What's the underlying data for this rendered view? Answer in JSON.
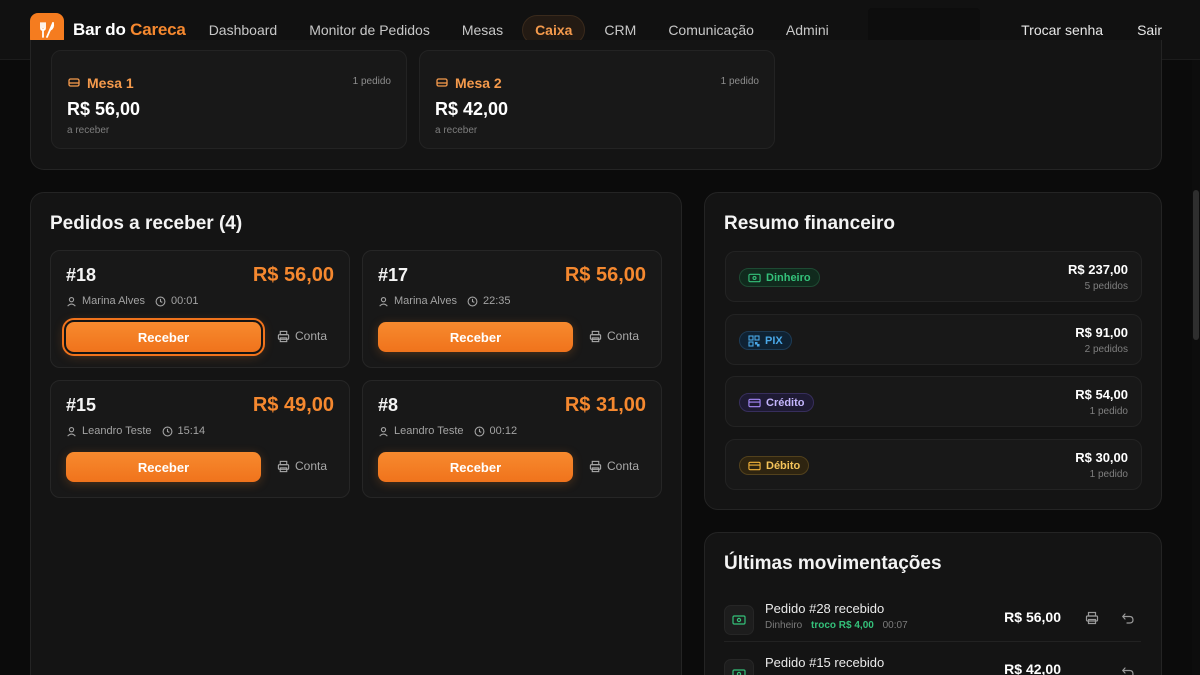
{
  "brand": {
    "name_part1": "Bar do ",
    "name_part2": "Careca",
    "accent": "#f5882f"
  },
  "nav": {
    "items": [
      {
        "label": "Dashboard",
        "active": false
      },
      {
        "label": "Monitor de Pedidos",
        "active": false
      },
      {
        "label": "Mesas",
        "active": false
      },
      {
        "label": "Caixa",
        "active": true
      },
      {
        "label": "CRM",
        "active": false
      },
      {
        "label": "Comunicação",
        "active": false
      },
      {
        "label": "Admini",
        "active": false
      }
    ],
    "change_password": "Trocar senha",
    "logout": "Sair"
  },
  "mesas": [
    {
      "name": "Mesa 1",
      "count": "1 pedido",
      "value": "R$ 56,00",
      "sub": "a receber",
      "icon": "table-icon"
    },
    {
      "name": "Mesa 2",
      "count": "1 pedido",
      "value": "R$ 42,00",
      "sub": "a receber",
      "icon": "table-icon"
    }
  ],
  "pedidos": {
    "title": "Pedidos a receber (4)",
    "receive_label": "Receber",
    "bill_label": "Conta",
    "orders": [
      {
        "id": "#18",
        "total": "R$ 56,00",
        "customer": "Marina Alves",
        "time": "00:01",
        "focused": true
      },
      {
        "id": "#17",
        "total": "R$ 56,00",
        "customer": "Marina Alves",
        "time": "22:35",
        "focused": false
      },
      {
        "id": "#15",
        "total": "R$ 49,00",
        "customer": "Leandro Teste",
        "time": "15:14",
        "focused": false
      },
      {
        "id": "#8",
        "total": "R$ 31,00",
        "customer": "Leandro Teste",
        "time": "00:12",
        "focused": false
      }
    ]
  },
  "resumo": {
    "title": "Resumo financeiro",
    "rows": [
      {
        "label": "Dinheiro",
        "value": "R$ 237,00",
        "count": "5 pedidos",
        "color": "#34c17a",
        "icon": "cash-icon"
      },
      {
        "label": "PIX",
        "value": "R$ 91,00",
        "count": "2 pedidos",
        "color": "#4aa8e8",
        "icon": "qr-code-icon"
      },
      {
        "label": "Crédito",
        "value": "R$ 54,00",
        "count": "1 pedido",
        "color": "#a78bfa",
        "icon": "credit-card-icon"
      },
      {
        "label": "Débito",
        "value": "R$ 30,00",
        "count": "1 pedido",
        "color": "#f5b43a",
        "icon": "debit-card-icon"
      }
    ]
  },
  "movimentacoes": {
    "title": "Últimas movimentações",
    "items": [
      {
        "title": "Pedido #28 recebido",
        "method": "Dinheiro",
        "troco": "troco R$ 4,00",
        "time": "00:07",
        "value": "R$ 56,00",
        "printable": true
      },
      {
        "title": "Pedido #15 recebido",
        "method": "",
        "troco": "",
        "time": "",
        "value": "R$ 42,00",
        "printable": false
      }
    ]
  }
}
